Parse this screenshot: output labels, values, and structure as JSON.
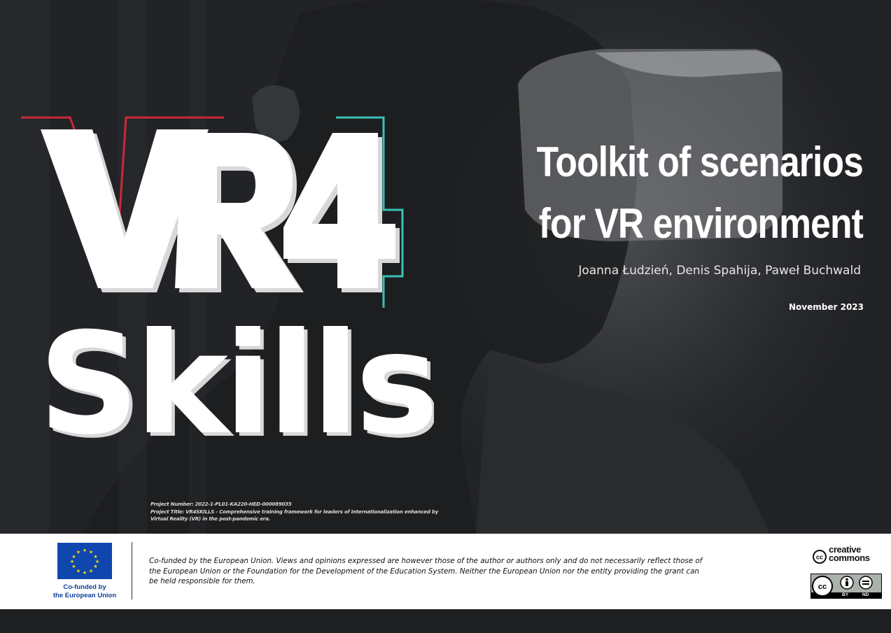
{
  "logo": {
    "line1": "VR4",
    "line2": "Skills",
    "accent_red": "#e0283c",
    "accent_teal": "#3fd3c7"
  },
  "title": {
    "line1": "Toolkit of scenarios",
    "line2": "for VR environment"
  },
  "authors": "Joanna Łudzień, Denis Spahija, Paweł Buchwald",
  "date": "November 2023",
  "project": {
    "number": "Project Number: 2022-1-PL01-KA220-HED-000089035",
    "title_line1": "Project Title: VR4SKILLS - Comprehensive training framework for leaders of internationalization enhanced by",
    "title_line2": "Virtual Reality (VR) in the post-pandemic era."
  },
  "footer": {
    "eu_label_line1": "Co-funded by",
    "eu_label_line2": "the European Union",
    "eu_flag_color": "#0f47af",
    "eu_star_color": "#ffdd00",
    "disclaimer": "Co-funded by the European Union. Views and opinions expressed are however those of the author or authors only and do not necessarily reflect those of the European Union or the Foundation for the Development of the Education System. Neither the European Union nor the entity providing the grant can be held responsible for them.",
    "cc_word_line1": "creative",
    "cc_word_line2": "commons",
    "cc_badge_by": "BY",
    "cc_badge_nd": "ND"
  }
}
